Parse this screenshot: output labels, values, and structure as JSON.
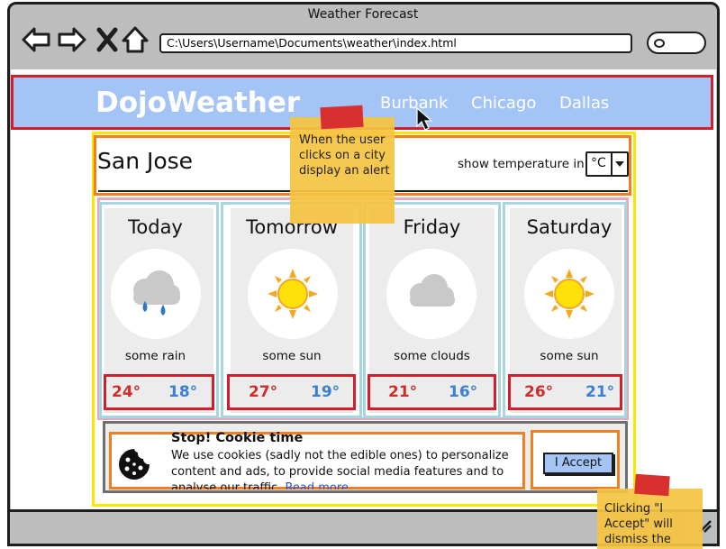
{
  "browser": {
    "title": "Weather Forecast",
    "address": "C:\\Users\\Username\\Documents\\weather\\index.html",
    "icons": [
      "back-arrow-icon",
      "forward-arrow-icon",
      "close-x-icon",
      "home-icon",
      "search-icon"
    ]
  },
  "navbar": {
    "logo": "DojoWeather",
    "cities": [
      "Burbank",
      "Chicago",
      "Dallas"
    ]
  },
  "header": {
    "city": "San Jose",
    "temp_label": "show temperature in",
    "unit": "°C"
  },
  "forecast": [
    {
      "day": "Today",
      "icon": "rain-cloud-icon",
      "desc": "some rain",
      "high": "24°",
      "low": "18°"
    },
    {
      "day": "Tomorrow",
      "icon": "sun-icon",
      "desc": "some sun",
      "high": "27°",
      "low": "19°"
    },
    {
      "day": "Friday",
      "icon": "cloud-icon",
      "desc": "some clouds",
      "high": "21°",
      "low": "16°"
    },
    {
      "day": "Saturday",
      "icon": "sun-icon",
      "desc": "some sun",
      "high": "26°",
      "low": "21°"
    }
  ],
  "cookie": {
    "title": "Stop! Cookie time",
    "body": "We use cookies (sadly not the edible ones) to personalize content and ads, to provide social media features and to analyse our traffic.",
    "read_more": "Read more",
    "accept": "I Accept",
    "icon": "cookie-icon"
  },
  "notes": {
    "city_click": "When the user clicks on a city display an alert",
    "accept_click": "Clicking \"I Accept\" will dismiss the"
  },
  "colors": {
    "navbar": "#a3c4f4",
    "high": "#cf2d2d",
    "low": "#3b7fd4",
    "sticky": "#f5c443"
  }
}
